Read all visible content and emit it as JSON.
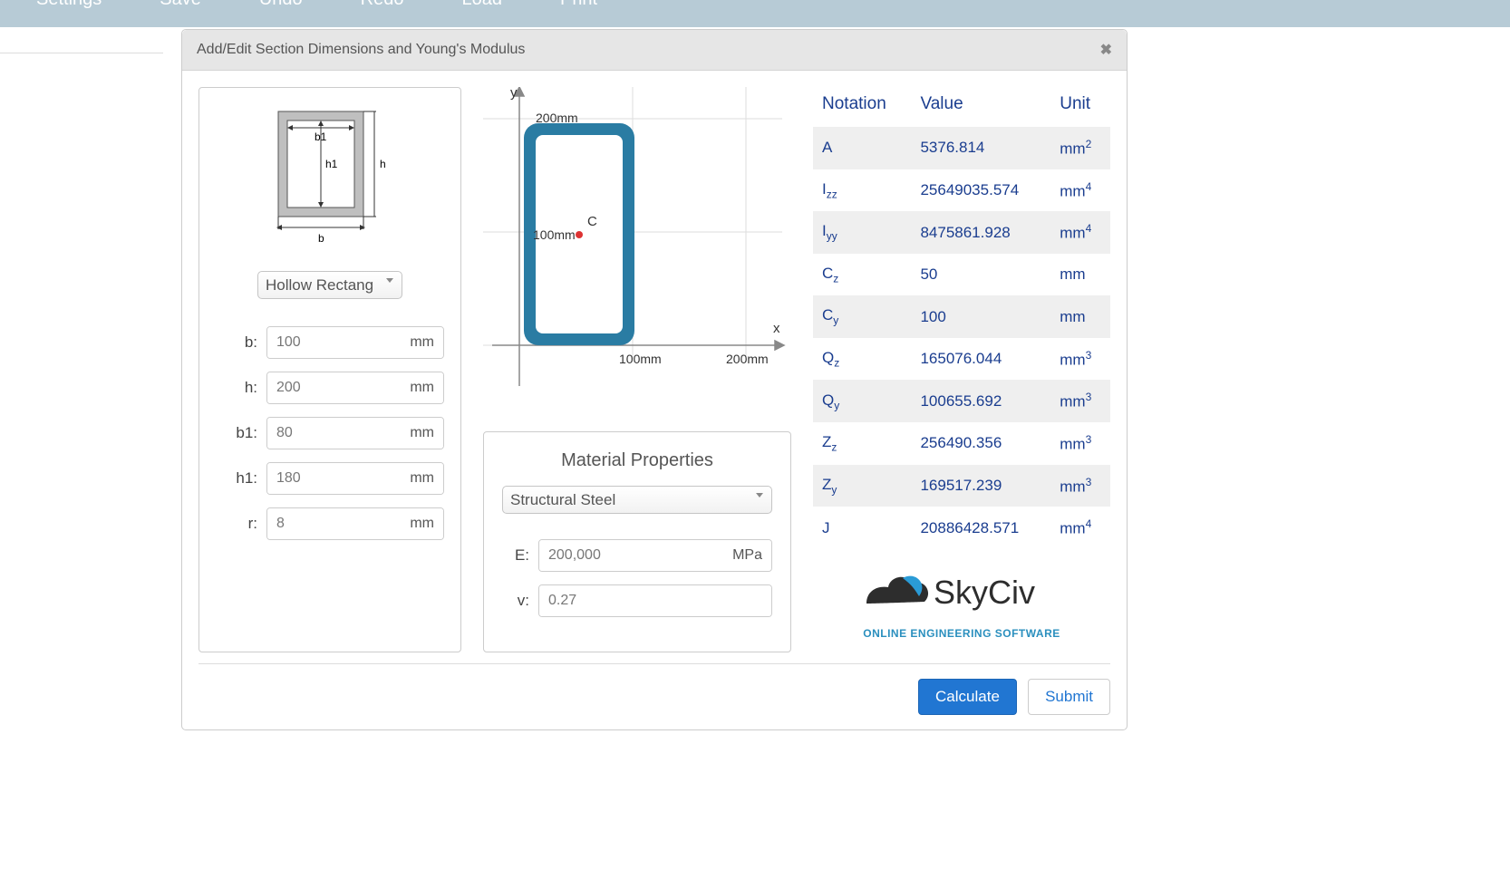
{
  "topbar": {
    "items": [
      "Settings",
      "Save",
      "Undo",
      "Redo",
      "Load",
      "Print"
    ]
  },
  "dialog": {
    "title": "Add/Edit Section Dimensions and Young's Modulus"
  },
  "shape": {
    "select_label": "Hollow Rectang",
    "diagram": {
      "b": "b",
      "h": "h",
      "b1": "b1",
      "h1": "h1"
    },
    "inputs": [
      {
        "key": "b",
        "label": "b:",
        "value": "100",
        "unit": "mm"
      },
      {
        "key": "h",
        "label": "h:",
        "value": "200",
        "unit": "mm"
      },
      {
        "key": "b1",
        "label": "b1:",
        "value": "80",
        "unit": "mm"
      },
      {
        "key": "h1",
        "label": "h1:",
        "value": "180",
        "unit": "mm"
      },
      {
        "key": "r",
        "label": "r:",
        "value": "8",
        "unit": "mm"
      }
    ]
  },
  "graph": {
    "x_axis": "x",
    "y_axis": "y",
    "ticks_x": [
      "100mm",
      "200mm"
    ],
    "tick_y": "100mm",
    "top_label": "200mm",
    "centroid_label": "C"
  },
  "material": {
    "heading": "Material Properties",
    "material_select": "Structural Steel",
    "rows": [
      {
        "label": "E:",
        "value": "200,000",
        "unit": "MPa"
      },
      {
        "label": "v:",
        "value": "0.27",
        "unit": ""
      }
    ]
  },
  "props": {
    "headers": {
      "notation": "Notation",
      "value": "Value",
      "unit": "Unit"
    },
    "rows": [
      {
        "n": "A",
        "sub": "",
        "v": "5376.814",
        "u": "mm",
        "sup": "2"
      },
      {
        "n": "I",
        "sub": "zz",
        "v": "25649035.574",
        "u": "mm",
        "sup": "4"
      },
      {
        "n": "I",
        "sub": "yy",
        "v": "8475861.928",
        "u": "mm",
        "sup": "4"
      },
      {
        "n": "C",
        "sub": "z",
        "v": "50",
        "u": "mm",
        "sup": ""
      },
      {
        "n": "C",
        "sub": "y",
        "v": "100",
        "u": "mm",
        "sup": ""
      },
      {
        "n": "Q",
        "sub": "z",
        "v": "165076.044",
        "u": "mm",
        "sup": "3"
      },
      {
        "n": "Q",
        "sub": "y",
        "v": "100655.692",
        "u": "mm",
        "sup": "3"
      },
      {
        "n": "Z",
        "sub": "z",
        "v": "256490.356",
        "u": "mm",
        "sup": "3"
      },
      {
        "n": "Z",
        "sub": "y",
        "v": "169517.239",
        "u": "mm",
        "sup": "3"
      },
      {
        "n": "J",
        "sub": "",
        "v": "20886428.571",
        "u": "mm",
        "sup": "4"
      }
    ]
  },
  "logo": {
    "brand": "SkyCiv",
    "tagline": "ONLINE ENGINEERING SOFTWARE"
  },
  "footer": {
    "calculate": "Calculate",
    "submit": "Submit"
  }
}
